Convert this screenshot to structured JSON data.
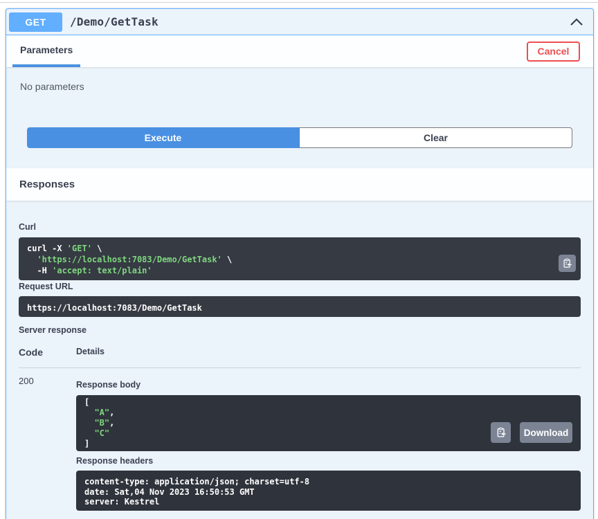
{
  "colors": {
    "accent_blue": "#61affe",
    "execute_blue": "#4990e2",
    "cancel_red": "#f04e4e",
    "code_green": "#7ed77e",
    "block_bg": "#ebf3fb"
  },
  "operation": {
    "method": "GET",
    "path": "/Demo/GetTask"
  },
  "tabs": {
    "parameters_label": "Parameters",
    "cancel_label": "Cancel"
  },
  "parameters": {
    "empty_text": "No parameters"
  },
  "actions": {
    "execute_label": "Execute",
    "clear_label": "Clear"
  },
  "responses": {
    "section_title": "Responses",
    "curl_label": "Curl",
    "curl_tokens": [
      {
        "t": "curl -X ",
        "c": "p"
      },
      {
        "t": "'GET'",
        "c": "s"
      },
      {
        "t": " \\\n",
        "c": "p"
      },
      {
        "t": "  ",
        "c": "p"
      },
      {
        "t": "'https://localhost:7083/Demo/GetTask'",
        "c": "s"
      },
      {
        "t": " \\\n",
        "c": "p"
      },
      {
        "t": "  -H ",
        "c": "p"
      },
      {
        "t": "'accept: text/plain'",
        "c": "s"
      }
    ],
    "request_url_label": "Request URL",
    "request_url": "https://localhost:7083/Demo/GetTask",
    "server_response_label": "Server response",
    "table": {
      "code_header": "Code",
      "details_header": "Details"
    },
    "response": {
      "code": "200",
      "body_label": "Response body",
      "body_tokens": [
        {
          "t": "[\n",
          "c": "p"
        },
        {
          "t": "  ",
          "c": "p"
        },
        {
          "t": "\"A\"",
          "c": "s"
        },
        {
          "t": ",\n",
          "c": "p"
        },
        {
          "t": "  ",
          "c": "p"
        },
        {
          "t": "\"B\"",
          "c": "s"
        },
        {
          "t": ",\n",
          "c": "p"
        },
        {
          "t": "  ",
          "c": "p"
        },
        {
          "t": "\"C\"",
          "c": "s"
        },
        {
          "t": "\n",
          "c": "p"
        },
        {
          "t": "]",
          "c": "p"
        }
      ],
      "download_label": "Download",
      "headers_label": "Response headers",
      "headers_lines": [
        "content-type: application/json; charset=utf-8",
        "date: Sat,04 Nov 2023 16:50:53 GMT",
        "server: Kestrel"
      ]
    }
  }
}
